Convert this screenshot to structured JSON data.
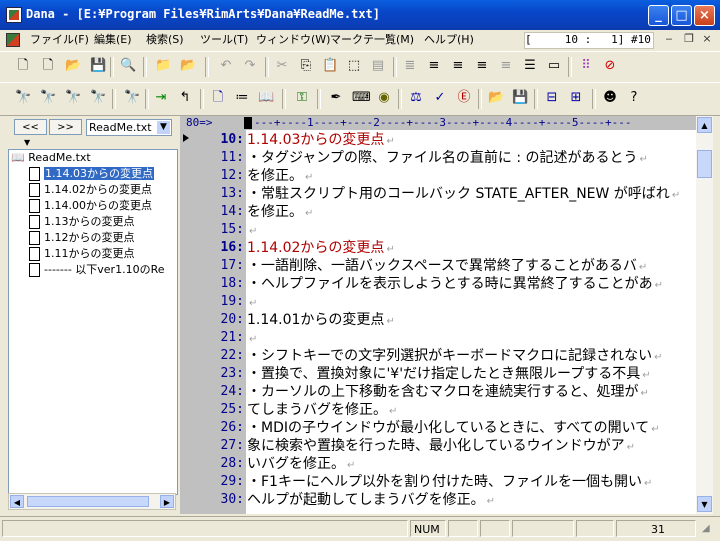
{
  "window": {
    "title": "Dana - [E:¥Program Files¥RimArts¥Dana¥ReadMe.txt]",
    "minimize": "_",
    "maximize": "□",
    "close": "×"
  },
  "menu": {
    "items": [
      "ファイル(F)",
      "編集(E)",
      "検索(S)",
      "ツール(T)",
      "ウィンドウ(W)",
      "マークテ一覧(M)",
      "ヘルプ(H)"
    ],
    "caret_position": "[     10 :   1] #10"
  },
  "left_panel": {
    "back_button": "<<",
    "forward_button": ">>",
    "file_select": "ReadMe.txt",
    "tree_root": "ReadMe.txt",
    "tree_items": [
      "1.14.03からの変更点",
      "1.14.02からの変更点",
      "1.14.00からの変更点",
      "1.13からの変更点",
      "1.12からの変更点",
      "1.11からの変更点",
      "------- 以下ver1.10のRe"
    ]
  },
  "editor": {
    "ruler_position": "80=>",
    "ruler_scale": "---+----1----+----2----+----3----+----4----+----5----+---",
    "lines": [
      {
        "no": "10:",
        "text": "1.14.03からの変更点",
        "style": "red",
        "current": true
      },
      {
        "no": "11:",
        "text": "・タグジャンプの際、ファイル名の直前に : の記述があるとう"
      },
      {
        "no": "12:",
        "text": "  を修正。"
      },
      {
        "no": "13:",
        "text": "・常駐スクリプト用のコールバック STATE_AFTER_NEW が呼ばれ"
      },
      {
        "no": "14:",
        "text": "  を修正。"
      },
      {
        "no": "15:",
        "text": ""
      },
      {
        "no": "16:",
        "text": "1.14.02からの変更点",
        "style": "red",
        "current": true
      },
      {
        "no": "17:",
        "text": "・一語削除、一語バックスペースで異常終了することがあるバ"
      },
      {
        "no": "18:",
        "text": "・ヘルプファイルを表示しようとする時に異常終了することがあ"
      },
      {
        "no": "19:",
        "text": ""
      },
      {
        "no": "20:",
        "text": "1.14.01からの変更点"
      },
      {
        "no": "21:",
        "text": ""
      },
      {
        "no": "22:",
        "text": "・シフトキーでの文字列選択がキーボードマクロに記録されない"
      },
      {
        "no": "23:",
        "text": "・置換で、置換対象に'¥'だけ指定したとき無限ループする不具"
      },
      {
        "no": "24:",
        "text": "・カーソルの上下移動を含むマクロを連続実行すると、処理が"
      },
      {
        "no": "25:",
        "text": "  てしまうバグを修正。"
      },
      {
        "no": "26:",
        "text": "・MDIの子ウインドウが最小化しているときに、すべての開いて"
      },
      {
        "no": "27:",
        "text": "  象に検索や置換を行った時、最小化しているウインドウがア"
      },
      {
        "no": "28:",
        "text": "  いバグを修正。"
      },
      {
        "no": "29:",
        "text": "・F1キーにヘルプ以外を割り付けた時、ファイルを一個も開い"
      },
      {
        "no": "30:",
        "text": "  ヘルプが起動してしまうバグを修正。"
      }
    ]
  },
  "status": {
    "num": "NUM",
    "lines": "31"
  }
}
